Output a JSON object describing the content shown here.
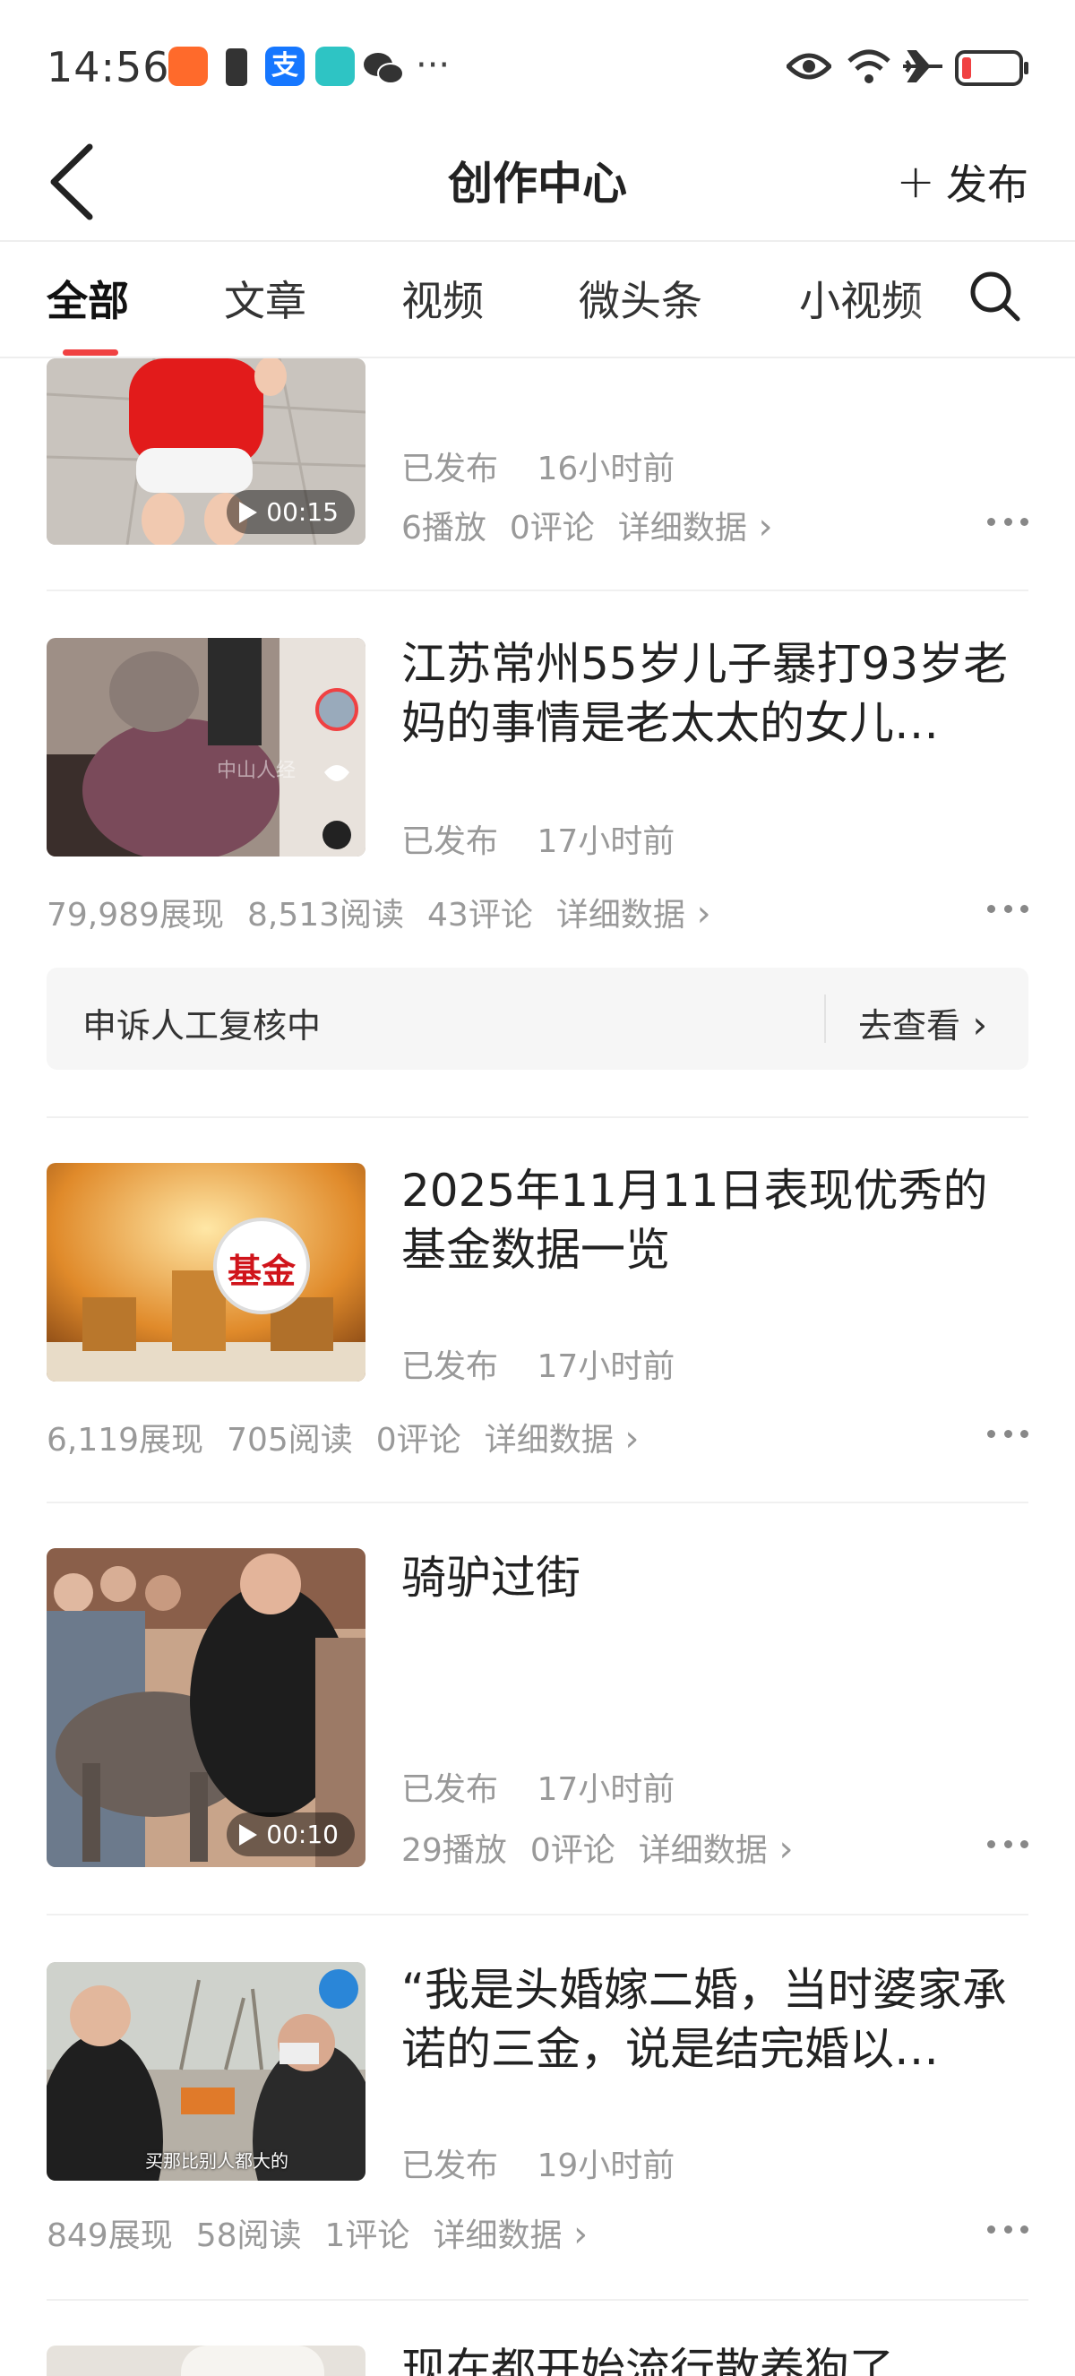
{
  "status_bar": {
    "time": "14:56",
    "more": "···"
  },
  "header": {
    "title": "创作中心",
    "publish_label": "发布"
  },
  "tabs": [
    "全部",
    "文章",
    "视频",
    "微头条",
    "小视频"
  ],
  "items": [
    {
      "title": "",
      "status": "已发布",
      "time": "16小时前",
      "duration": "00:15",
      "stats": [
        "6播放",
        "0评论"
      ],
      "detail_label": "详细数据"
    },
    {
      "title": "江苏常州55岁儿子暴打93岁老妈的事情是老太太的女儿…",
      "status": "已发布",
      "time": "17小时前",
      "stats": [
        "79,989展现",
        "8,513阅读",
        "43评论"
      ],
      "detail_label": "详细数据",
      "thumb_watermark": "中山人经"
    },
    {
      "title": "2025年11月11日表现优秀的基金数据一览",
      "status": "已发布",
      "time": "17小时前",
      "stats": [
        "6,119展现",
        "705阅读",
        "0评论"
      ],
      "detail_label": "详细数据",
      "thumb_text": "基金"
    },
    {
      "title": "骑驴过街",
      "status": "已发布",
      "time": "17小时前",
      "duration": "00:10",
      "stats": [
        "29播放",
        "0评论"
      ],
      "detail_label": "详细数据"
    },
    {
      "title": "“我是头婚嫁二婚，当时婆家承诺的三金，说是结完婚以…",
      "status": "已发布",
      "time": "19小时前",
      "stats": [
        "849展现",
        "58阅读",
        "1评论"
      ],
      "detail_label": "详细数据",
      "thumb_caption": "买那比别人都大的"
    },
    {
      "title": "现在都开始流行散养狗了"
    }
  ],
  "appeal": {
    "text": "申诉人工复核中",
    "link": "去查看"
  },
  "colors": {
    "accent": "#f04142",
    "muted": "#999999",
    "appeal_bg": "#f6f6f6"
  }
}
